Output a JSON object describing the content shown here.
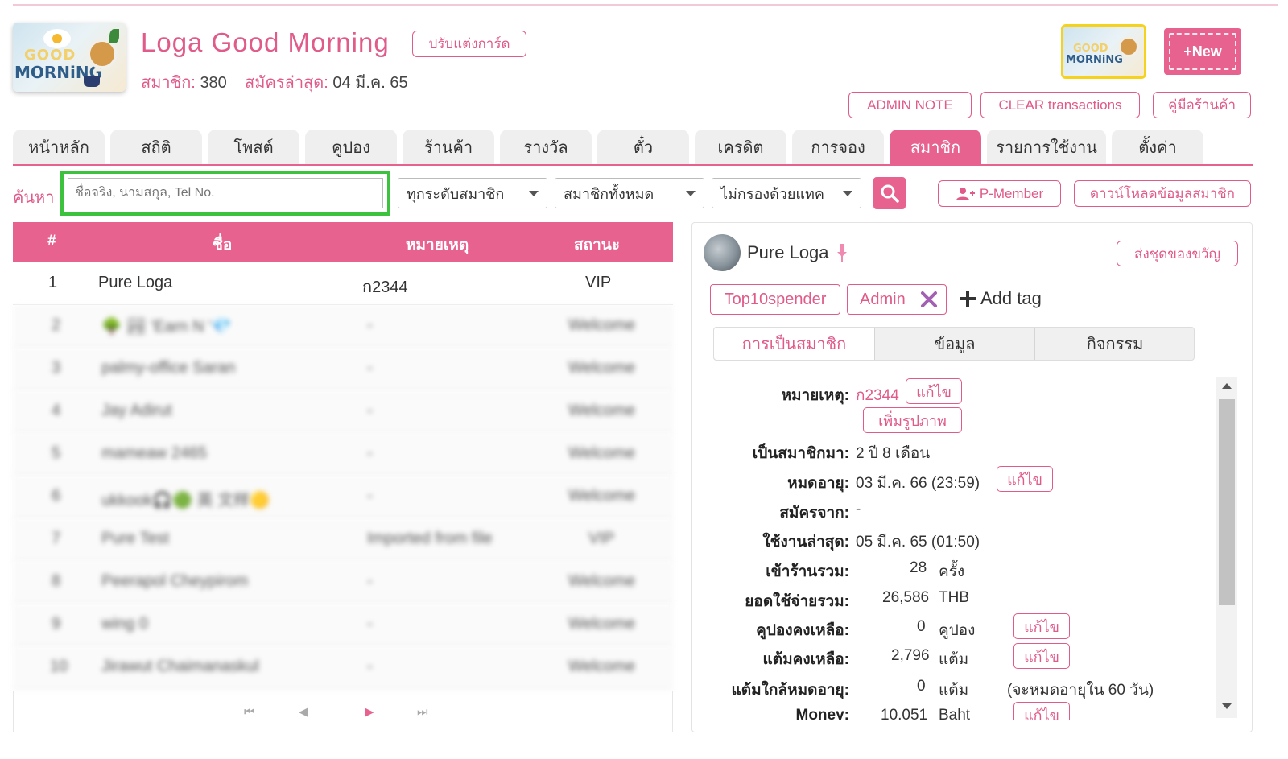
{
  "shop": {
    "name": "Loga  Good  Morning",
    "customize_card": "ปรับแต่งการ์ด",
    "members_label": "สมาชิก:",
    "members_count": "380",
    "last_signup_label": "สมัครล่าสุด:",
    "last_signup_date": "04 มี.ค. 65",
    "logo_good": "GOOD",
    "logo_morning": "MORNiNG",
    "new_button": "+New"
  },
  "header_buttons": {
    "admin_note": "ADMIN NOTE",
    "clear_transactions": "CLEAR transactions",
    "shop_manual": "คู่มือร้านค้า"
  },
  "tabs": [
    {
      "label": "หน้าหลัก",
      "active": false
    },
    {
      "label": "สถิติ",
      "active": false
    },
    {
      "label": "โพสต์",
      "active": false
    },
    {
      "label": "คูปอง",
      "active": false
    },
    {
      "label": "ร้านค้า",
      "active": false
    },
    {
      "label": "รางวัล",
      "active": false
    },
    {
      "label": "ตั๋ว",
      "active": false
    },
    {
      "label": "เครดิต",
      "active": false
    },
    {
      "label": "การจอง",
      "active": false
    },
    {
      "label": "สมาชิก",
      "active": true
    },
    {
      "label": "รายการใช้งาน",
      "active": false
    },
    {
      "label": "ตั้งค่า",
      "active": false
    }
  ],
  "search": {
    "label": "ค้นหา",
    "placeholder": "ชื่อจริง, นามสกุล, Tel No.",
    "filter_level": "ทุกระดับสมาชิก",
    "filter_members": "สมาชิกทั้งหมด",
    "filter_tag": "ไม่กรองด้วยแทค",
    "p_member": "P-Member",
    "download": "ดาวน์โหลดข้อมูลสมาชิก"
  },
  "table": {
    "columns": [
      "#",
      "ชื่อ",
      "หมายเหตุ",
      "สถานะ"
    ],
    "rows": [
      {
        "num": "1",
        "name": "Pure Loga",
        "note": "ก2344",
        "status": "VIP"
      },
      {
        "num": "2",
        "name": "🌳 🏞 'Earn N '💎",
        "note": "-",
        "status": "Welcome"
      },
      {
        "num": "3",
        "name": "palmy-office Saran",
        "note": "-",
        "status": "Welcome"
      },
      {
        "num": "4",
        "name": "Jay Adirut",
        "note": "-",
        "status": "Welcome"
      },
      {
        "num": "5",
        "name": "mameaw 2465",
        "note": "-",
        "status": "Welcome"
      },
      {
        "num": "6",
        "name": "ukkook🎧🟢 英 文样🟡",
        "note": "-",
        "status": "Welcome"
      },
      {
        "num": "7",
        "name": "Pure Test",
        "note": "Imported from file",
        "status": "VIP"
      },
      {
        "num": "8",
        "name": "Peerapol Cheypirom",
        "note": "-",
        "status": "Welcome"
      },
      {
        "num": "9",
        "name": "wing 0",
        "note": "-",
        "status": "Welcome"
      },
      {
        "num": "10",
        "name": "Jirawut Chaimanaskul",
        "note": "-",
        "status": "Welcome"
      }
    ],
    "pager": {
      "first": "⏮",
      "prev": "◀",
      "next": "▶",
      "last": "⏭"
    }
  },
  "member": {
    "name": "Pure  Loga",
    "send_gift": "ส่งชุดของขวัญ",
    "tags": [
      "Top10spender",
      "Admin"
    ],
    "add_tag": "Add  tag",
    "subtabs": [
      "การเป็นสมาชิก",
      "ข้อมูล",
      "กิจกรรม"
    ],
    "edit_label": "แก้ไข",
    "add_photo": "เพิ่มรูปภาพ",
    "details": {
      "note_label": "หมายเหตุ:",
      "note_value": "ก2344",
      "tenure_label": "เป็นสมาชิกมา:",
      "tenure_value": "2  ปี  8  เดือน",
      "expire_label": "หมดอายุ:",
      "expire_value": "03  มี.ค.  66  (23:59)",
      "from_label": "สมัครจาก:",
      "from_value": "-",
      "last_used_label": "ใช้งานล่าสุด:",
      "last_used_value": "05  มี.ค.  65  (01:50)",
      "visits_label": "เข้าร้านรวม:",
      "visits_value": "28",
      "visits_unit": "ครั้ง",
      "spend_label": "ยอดใช้จ่ายรวม:",
      "spend_value": "26,586",
      "spend_unit": "THB",
      "coupons_label": "คูปองคงเหลือ:",
      "coupons_value": "0",
      "coupons_unit": "คูปอง",
      "points_label": "แต้มคงเหลือ:",
      "points_value": "2,796",
      "points_unit": "แต้ม",
      "expiring_label": "แต้มใกล้หมดอายุ:",
      "expiring_value": "0",
      "expiring_unit": "แต้ม",
      "expiring_note": "(จะหมดอายุใน  60  วัน)",
      "money_label": "Money:",
      "money_value": "10,051",
      "money_unit": "Baht"
    }
  },
  "colors": {
    "accent": "#e8628f",
    "highlight_border": "#3cc23c",
    "logo_border": "#f5d21d"
  }
}
